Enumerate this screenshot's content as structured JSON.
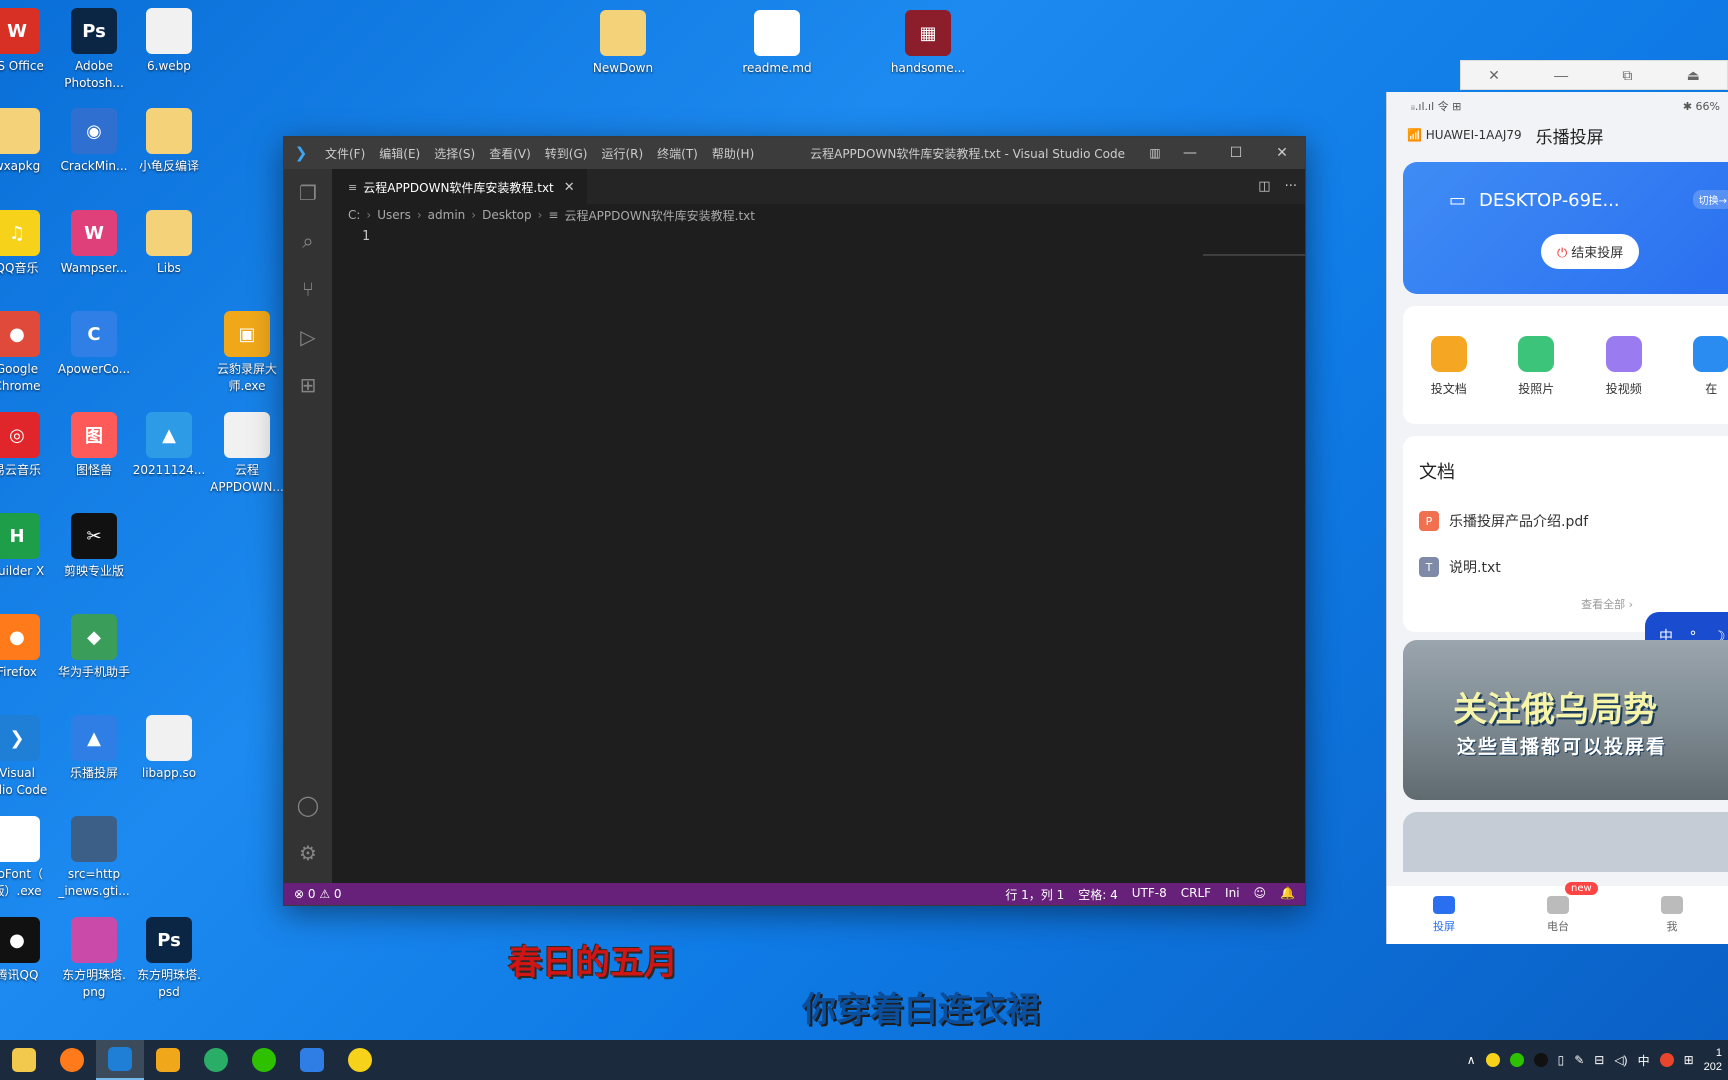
{
  "desktop": {
    "icons": [
      {
        "label": "PS Office",
        "glyph": "W",
        "color": "#d93025"
      },
      {
        "label": "Adobe\nPhotosh...",
        "glyph": "Ps",
        "color": "#0b2545"
      },
      {
        "label": "6.webp",
        "glyph": "",
        "color": "#f1f1f1"
      },
      {
        "label": "NewDown",
        "glyph": "",
        "color": "#f4d27a"
      },
      {
        "label": "readme.md",
        "glyph": "↓",
        "color": "#ffffff"
      },
      {
        "label": "handsome...",
        "glyph": "▦",
        "color": "#8b1e2a"
      },
      {
        "label": "wxapkg",
        "glyph": "",
        "color": "#f4d27a"
      },
      {
        "label": "CrackMin...",
        "glyph": "◉",
        "color": "#2f6fd0"
      },
      {
        "label": "小龟反编译",
        "glyph": "",
        "color": "#f4d27a"
      },
      {
        "label": "QQ音乐",
        "glyph": "♫",
        "color": "#f6d21a"
      },
      {
        "label": "Wampser...",
        "glyph": "W",
        "color": "#e0407a"
      },
      {
        "label": "Libs",
        "glyph": "",
        "color": "#f4d27a"
      },
      {
        "label": "Google\nChrome",
        "glyph": "●",
        "color": "#e04a3a"
      },
      {
        "label": "ApowerCo...",
        "glyph": "C",
        "color": "#2f7fe6"
      },
      {
        "label": "云豹录屏大\n师.exe",
        "glyph": "▣",
        "color": "#f0a81a"
      },
      {
        "label": "易云音乐",
        "glyph": "◎",
        "color": "#e0262b"
      },
      {
        "label": "图怪兽",
        "glyph": "图",
        "color": "#ff5a5a"
      },
      {
        "label": "20211124...",
        "glyph": "▲",
        "color": "#2e9be6"
      },
      {
        "label": "云程\nAPPDOWN...",
        "glyph": "",
        "color": "#f1f1f1"
      },
      {
        "label": "Builder X",
        "glyph": "H",
        "color": "#1f9e4a"
      },
      {
        "label": "剪映专业版",
        "glyph": "✂",
        "color": "#111111"
      },
      {
        "label": "Firefox",
        "glyph": "●",
        "color": "#ff7a1a"
      },
      {
        "label": "华为手机助手",
        "glyph": "◆",
        "color": "#3a9e5a"
      },
      {
        "label": "Visual\nudio Code",
        "glyph": "❯",
        "color": "#1f7fd6"
      },
      {
        "label": "乐播投屏",
        "glyph": "▲",
        "color": "#2e7ee6"
      },
      {
        "label": "libapp.so",
        "glyph": "",
        "color": "#f1f1f1"
      },
      {
        "label": "lloFont（\n版）.exe",
        "glyph": "✎",
        "color": "#ffffff"
      },
      {
        "label": "src=http\n_inews.gti...",
        "glyph": "",
        "color": "#3b5f86"
      },
      {
        "label": "腾讯QQ",
        "glyph": "●",
        "color": "#111111"
      },
      {
        "label": "东方明珠塔.\npng",
        "glyph": "",
        "color": "#c94aa8"
      },
      {
        "label": "东方明珠塔.\npsd",
        "glyph": "Ps",
        "color": "#0b2545"
      }
    ]
  },
  "vscode": {
    "menu": [
      "文件(F)",
      "编辑(E)",
      "选择(S)",
      "查看(V)",
      "转到(G)",
      "运行(R)",
      "终端(T)",
      "帮助(H)"
    ],
    "window_title": "云程APPDOWN软件库安装教程.txt - Visual Studio Code",
    "tab_label": "云程APPDOWN软件库安装教程.txt",
    "breadcrumb": [
      "C:",
      "Users",
      "admin",
      "Desktop",
      "云程APPDOWN软件库安装教程.txt"
    ],
    "line_number": "1",
    "status": {
      "problems": "⊗ 0 ⚠ 0",
      "position": "行 1，列 1",
      "spaces": "空格: 4",
      "encoding": "UTF-8",
      "eol": "CRLF",
      "language": "Ini"
    }
  },
  "phone": {
    "status_left": "ᵢᵢ.ıl.ıl 令 ⊞",
    "status_right": "✱ 66%",
    "wifi_name": "HUAWEI-1AAJ79",
    "app_title": "乐播投屏",
    "device_name": "DESKTOP-69E...",
    "switch_label": "切换→",
    "end_cast_label": "结束投屏",
    "features": [
      {
        "label": "投文档",
        "color": "#f5a623"
      },
      {
        "label": "投照片",
        "color": "#3cc47a"
      },
      {
        "label": "投视频",
        "color": "#9b7cf0"
      },
      {
        "label": "在",
        "color": "#2a8cf0"
      }
    ],
    "docs_title": "文档",
    "docs": [
      {
        "name": "乐播投屏产品介绍.pdf",
        "icon": "P",
        "color": "#f07050"
      },
      {
        "name": "说明.txt",
        "icon": "T",
        "color": "#7f8aa8"
      }
    ],
    "see_all": "查看全部 ›",
    "ime_text": "中 ° ☽ 👕",
    "banner_title": "关注俄乌局势",
    "banner_sub": "这些直播都可以投屏看",
    "nav": [
      {
        "label": "投屏",
        "active": true
      },
      {
        "label": "电台",
        "badge": "new"
      },
      {
        "label": "我"
      }
    ]
  },
  "subtitles": {
    "line1": "春日的五月",
    "line2": "你穿着白连衣裙"
  },
  "taskbar": {
    "apps": [
      "file-explorer",
      "firefox",
      "vscode",
      "cheetah-recorder",
      "wechat-work",
      "wechat",
      "lebo-cast",
      "qq-music"
    ],
    "tray_lang": "中",
    "clock_time": "1",
    "clock_date": "202"
  }
}
